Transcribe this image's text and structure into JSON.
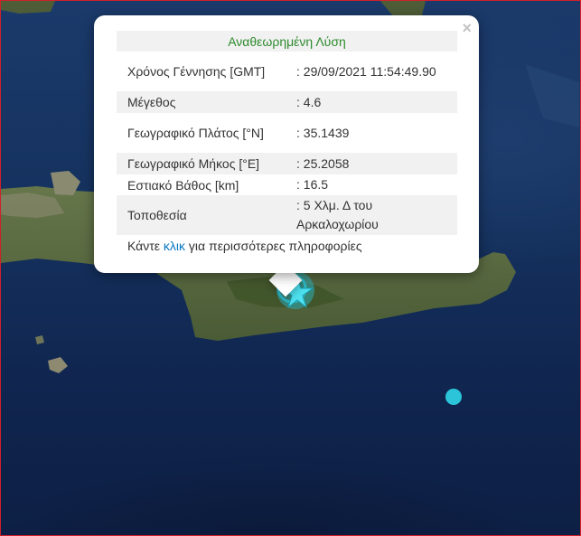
{
  "popup": {
    "title": "Αναθεωρημένη Λύση",
    "close": "×",
    "rows": [
      {
        "label": "Χρόνος Γέννησης [GMT]",
        "value": ": 29/09/2021 11:54:49.90"
      },
      {
        "label": "Μέγεθος",
        "value": ": 4.6"
      },
      {
        "label": "Γεωγραφικό Πλάτος [°N]",
        "value": ": 35.1439"
      },
      {
        "label": "Γεωγραφικό Μήκος [°E]",
        "value": ": 25.2058"
      },
      {
        "label": "Εστιακό Βάθος [km]",
        "value": ": 16.5"
      },
      {
        "label": "Τοποθεσία",
        "value": ": 5 Χλμ. Δ του Αρκαλοχωρίου"
      }
    ],
    "footer_prefix": "Κάντε ",
    "footer_link": "κλικ",
    "footer_suffix": " για περισσότερες πληροφορίες"
  },
  "colors": {
    "marker": "#2bc4d8",
    "link": "#0a78c2",
    "title": "#2d8a2d"
  },
  "markers": {
    "main": "star-icon",
    "secondary": "circle-icon"
  }
}
